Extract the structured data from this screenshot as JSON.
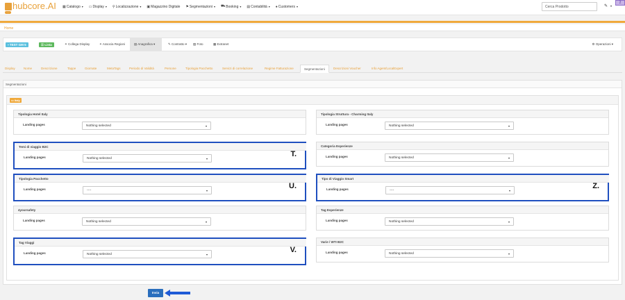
{
  "brand": {
    "logo": "hubcore.AI",
    "badge": "..."
  },
  "nav": {
    "items": [
      {
        "label": "Catalogo",
        "icon": "grid-icon"
      },
      {
        "label": "Display",
        "icon": "display-icon"
      },
      {
        "label": "Localizzazione",
        "icon": "pin-icon"
      },
      {
        "label": "Magazzino Digitale",
        "icon": "box-icon"
      },
      {
        "label": "Segmentazioni",
        "icon": "tag-icon"
      },
      {
        "label": "Booking",
        "icon": "cart-icon"
      },
      {
        "label": "Contabilità",
        "icon": "table-icon"
      },
      {
        "label": "Customers",
        "icon": "user-icon"
      }
    ],
    "search_placeholder": "Cerca Prodotto",
    "corner": "2"
  },
  "breadcrumb": "Home",
  "toolbar": {
    "badge1": "TEST GM 5",
    "badge2": "Lista",
    "items": [
      "Collega Display",
      "Associa Regioni",
      "Anagrafica",
      "Contratto",
      "Foto",
      "Extranet"
    ],
    "right": "Operazioni"
  },
  "tabs": [
    "Display",
    "Nome",
    "Descrizione",
    "Tappe",
    "Giornate",
    "MetaTags",
    "Periodo di Validità",
    "Persone",
    "Tipologia Pacchetto",
    "Servizi di correlazione",
    "Regime Fatturazione",
    "Segmentazioni",
    "Descrizioni Voucher",
    "Info Agent/LocalExpert"
  ],
  "panel_title": "Segmentazioni",
  "italy_badge": "Italy",
  "landing_label": "Landing pages",
  "fields": [
    {
      "title": "Tipologia Hotel Italy",
      "value": "Nothing selected",
      "letter": ""
    },
    {
      "title": "Tipologia Struttura - Charming Italy",
      "value": "Nothing selected",
      "letter": ""
    },
    {
      "title": "Temi di viaggio B2C",
      "value": "Nothing selected",
      "letter": "T."
    },
    {
      "title": "Categoria Esperienze",
      "value": "Nothing selected",
      "letter": ""
    },
    {
      "title": "Tipologia Pacchetto",
      "value": "----",
      "letter": "U."
    },
    {
      "title": "Tipo di Viaggio Smart",
      "value": "----",
      "letter": "Z."
    },
    {
      "title": "4yoursafety",
      "value": "Nothing selected",
      "letter": ""
    },
    {
      "title": "Tag Esperienze",
      "value": "Nothing selected",
      "letter": ""
    },
    {
      "title": "Tag Viaggi",
      "value": "Nothing selected",
      "letter": "V."
    },
    {
      "title": "Varie / WTI B2C",
      "value": "Nothing selected",
      "letter": ""
    }
  ],
  "submit": "Invia",
  "colors": {
    "accent": "#f0a93b",
    "highlight": "#1f4fbf",
    "button": "#2a6ebd"
  }
}
